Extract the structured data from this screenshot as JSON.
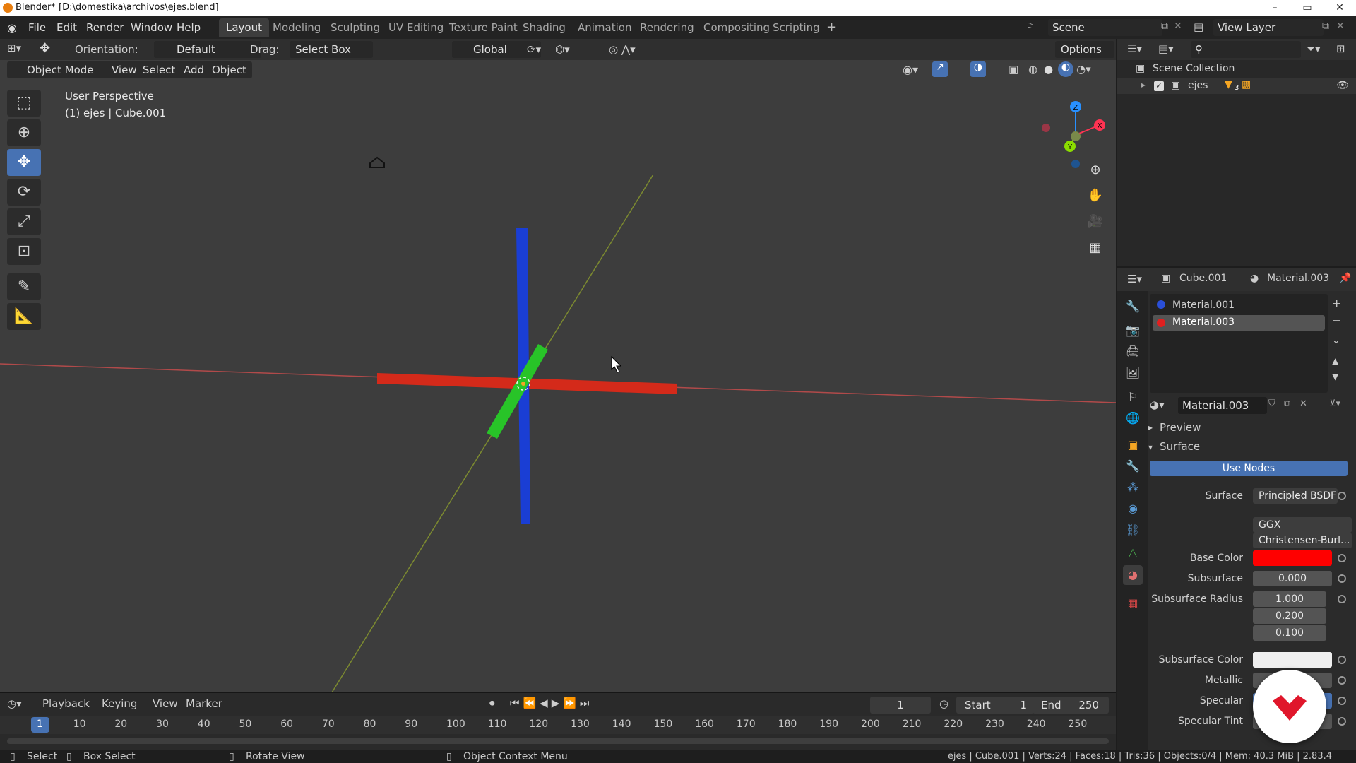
{
  "titlebar": {
    "title": "Blender* [D:\\domestika\\archivos\\ejes.blend]",
    "minimize": "–",
    "maximize": "▭",
    "close": "✕"
  },
  "menu": {
    "file": "File",
    "edit": "Edit",
    "render": "Render",
    "window": "Window",
    "help": "Help"
  },
  "workspaces": [
    "Layout",
    "Modeling",
    "Sculpting",
    "UV Editing",
    "Texture Paint",
    "Shading",
    "Animation",
    "Rendering",
    "Compositing",
    "Scripting"
  ],
  "scene": {
    "name": "Scene",
    "view_layer": "View Layer"
  },
  "tool_header": {
    "orientation_label": "Orientation:",
    "orientation_value": "Default",
    "drag_label": "Drag:",
    "drag_value": "Select Box",
    "transform_space": "Global",
    "options": "Options"
  },
  "view_header": {
    "mode": "Object Mode",
    "view": "View",
    "select": "Select",
    "add": "Add",
    "object": "Object"
  },
  "viewport": {
    "perspective": "User Perspective",
    "object_info": "(1) ejes | Cube.001",
    "gizmo_x": "X",
    "gizmo_y": "Y",
    "gizmo_z": "Z"
  },
  "timeline": {
    "playback": "Playback",
    "keying": "Keying",
    "view": "View",
    "marker": "Marker",
    "current_frame": "1",
    "start_label": "Start",
    "start": "1",
    "end_label": "End",
    "end": "250",
    "frames": [
      "1",
      "10",
      "20",
      "30",
      "40",
      "50",
      "60",
      "70",
      "80",
      "90",
      "100",
      "110",
      "120",
      "130",
      "140",
      "150",
      "160",
      "170",
      "180",
      "190",
      "200",
      "210",
      "220",
      "230",
      "240",
      "250"
    ]
  },
  "statusbar": {
    "select": "Select",
    "box_select": "Box Select",
    "rotate_view": "Rotate View",
    "context_menu": "Object Context Menu",
    "stats": "ejes | Cube.001 | Verts:24 | Faces:18 | Tris:36 | Objects:0/4 | Mem: 40.3 MiB | 2.83.4"
  },
  "outliner": {
    "root": "Scene Collection",
    "collection": "ejes",
    "child_count": "3"
  },
  "properties": {
    "object": "Cube.001",
    "material_header": "Material.003",
    "slots": [
      "Material.001",
      "Material.003"
    ],
    "material_name": "Material.003",
    "preview": "Preview",
    "surface_section": "Surface",
    "use_nodes": "Use Nodes",
    "surface_label": "Surface",
    "surface_value": "Principled BSDF",
    "distribution": "GGX",
    "subsurface_method": "Christensen-Burl...",
    "base_color_label": "Base Color",
    "subsurface_label": "Subsurface",
    "subsurface_value": "0.000",
    "subsurface_radius_label": "Subsurface Radius",
    "radius": [
      "1.000",
      "0.200",
      "0.100"
    ],
    "subsurface_color_label": "Subsurface Color",
    "metallic_label": "Metallic",
    "specular_label": "Specular",
    "specular_tint_label": "Specular Tint"
  },
  "colors": {
    "accent": "#4772b3",
    "base_color": "#ff0000",
    "x_axis": "#ff3352",
    "y_axis": "#8bdc00",
    "z_axis": "#2890ff"
  }
}
